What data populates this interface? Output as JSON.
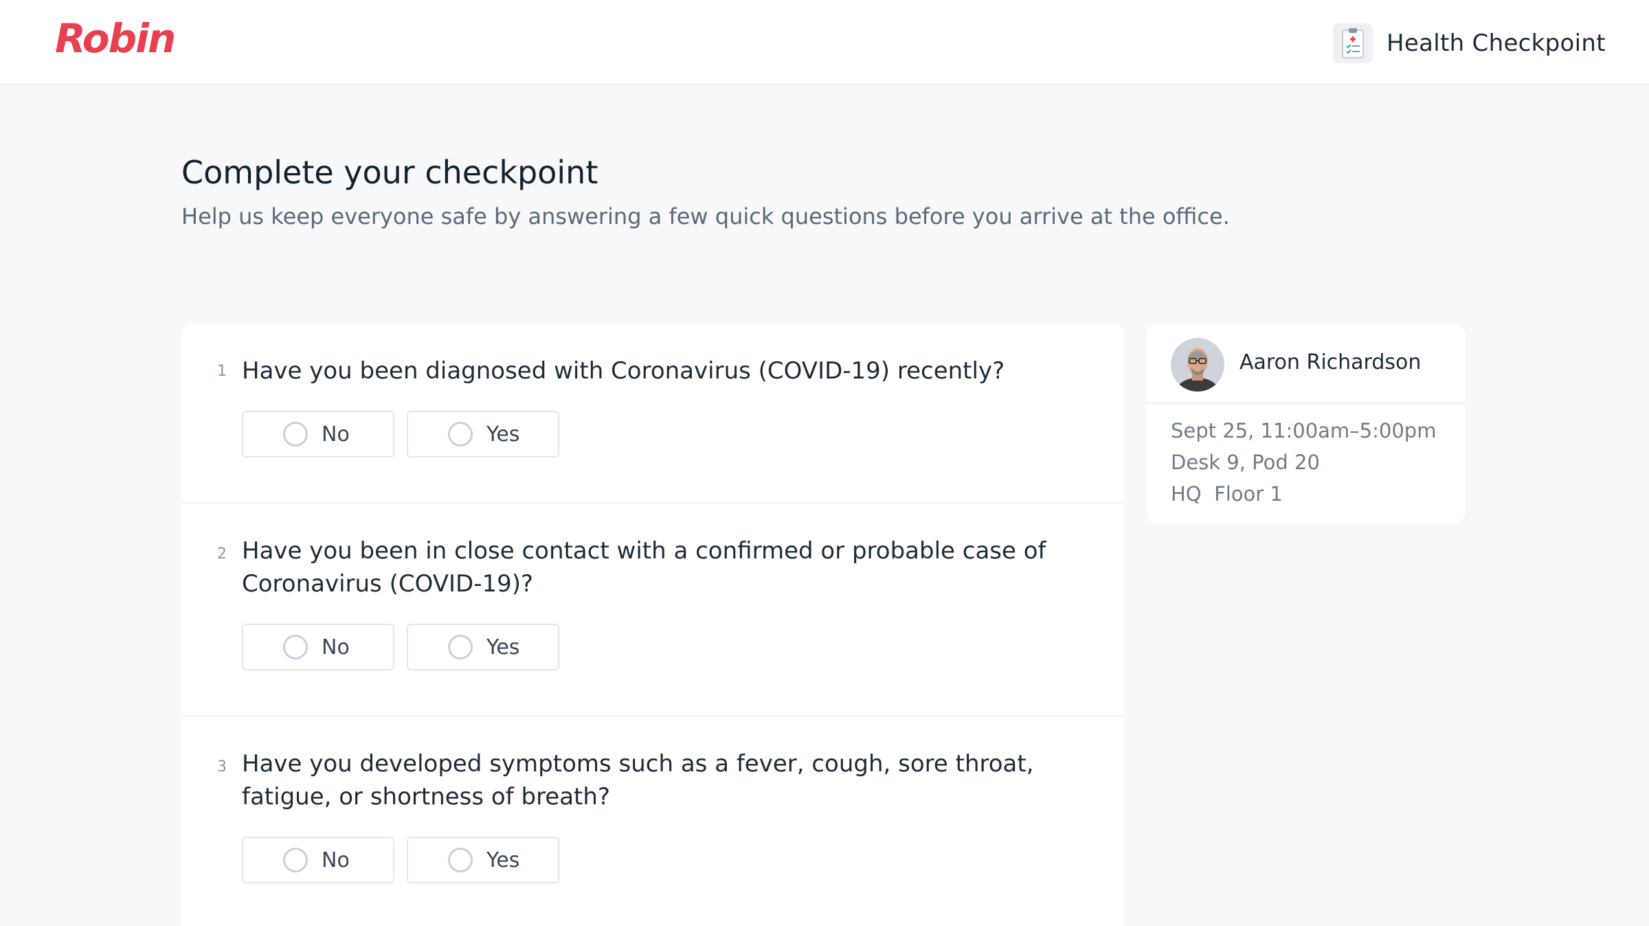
{
  "header": {
    "logo": "Robin",
    "product_label": "Health Checkpoint",
    "product_icon": "clipboard-health-icon"
  },
  "page": {
    "title": "Complete your checkpoint",
    "subtitle": "Help us keep everyone safe by answering a few quick questions before you arrive at the office."
  },
  "questions": [
    {
      "number": "1",
      "line1": "Have you been diagnosed with Coronavirus (COVID-19) recently?",
      "line2": "",
      "options": [
        "No",
        "Yes"
      ]
    },
    {
      "number": "2",
      "line1": "Have you been in close contact with a confirmed or probable case of",
      "line2": "Coronavirus (COVID-19)?",
      "options": [
        "No",
        "Yes"
      ]
    },
    {
      "number": "3",
      "line1": "Have you developed symptoms such as a fever, cough, sore throat,",
      "line2": "fatigue, or shortness of breath?",
      "options": [
        "No",
        "Yes"
      ]
    }
  ],
  "profile": {
    "name": "Aaron Richardson",
    "booking_time": "Sept 25, 11:00am–5:00pm",
    "desk": "Desk 9, Pod 20",
    "location": "HQ  Floor 1"
  },
  "colors": {
    "brand": "#e8404f",
    "background": "#f7f8fa",
    "card": "#ffffff"
  }
}
